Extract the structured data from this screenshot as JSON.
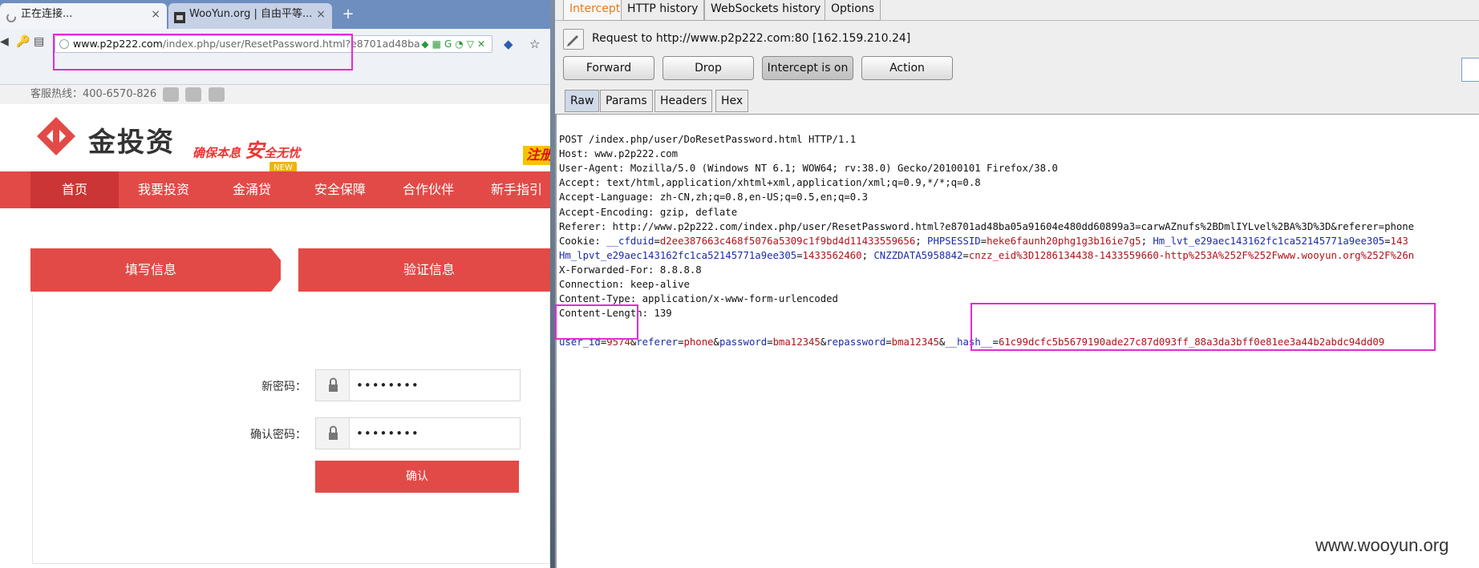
{
  "browser": {
    "tabs": [
      {
        "title": "正在连接...",
        "close": "×"
      },
      {
        "title": "WooYun.org | 自由平等...",
        "close": "×"
      }
    ],
    "new_tab": "+",
    "url_domain": "www.p2p222.com",
    "url_path": "/index.php/user/ResetPassword.html?e8701ad48ba"
  },
  "site": {
    "hotline": "客服热线：400-6570-826",
    "logo_text": "金投资",
    "slogan_pre": "确保本息",
    "slogan_big": "安",
    "slogan_post": "全无忧",
    "register_tag": "注册",
    "new_badge": "NEW",
    "nav": [
      "首页",
      "我要投资",
      "金涌贷",
      "安全保障",
      "合作伙伴",
      "新手指引"
    ],
    "steps": [
      "填写信息",
      "验证信息"
    ],
    "new_password_label": "新密码：",
    "confirm_password_label": "确认密码：",
    "new_password_value": "••••••••",
    "confirm_password_value": "••••••••",
    "confirm_button": "确认"
  },
  "burp": {
    "tabs": [
      "Intercept",
      "HTTP history",
      "WebSockets history",
      "Options"
    ],
    "request_to": "Request to http://www.p2p222.com:80  [162.159.210.24]",
    "buttons": [
      "Forward",
      "Drop",
      "Intercept is on",
      "Action"
    ],
    "sub_tabs": [
      "Raw",
      "Params",
      "Headers",
      "Hex"
    ],
    "raw_lines": [
      "POST /index.php/user/DoResetPassword.html HTTP/1.1",
      "Host: www.p2p222.com",
      "User-Agent: Mozilla/5.0 (Windows NT 6.1; WOW64; rv:38.0) Gecko/20100101 Firefox/38.0",
      "Accept: text/html,application/xhtml+xml,application/xml;q=0.9,*/*;q=0.8",
      "Accept-Language: zh-CN,zh;q=0.8,en-US;q=0.5,en;q=0.3",
      "Accept-Encoding: gzip, deflate",
      "Referer: http://www.p2p222.com/index.php/user/ResetPassword.html?e8701ad48ba05a91604e480dd60899a3=carwAZnufs%2BDmlIYLvel%2BA%3D%3D&referer=phone"
    ],
    "cookie_prefix": "Cookie: ",
    "cookie_parts": [
      {
        "k": "__cfduid",
        "v": "d2ee387663c468f5076a5309c1f9bd4d11433559656"
      },
      {
        "k": "PHPSESSID",
        "v": "heke6faunh20phg1g3b16ie7g5"
      },
      {
        "k": "Hm_lvt_e29aec143162fc1ca52145771a9ee305",
        "v": "143"
      }
    ],
    "cookie_line2": [
      {
        "k": "Hm_lpvt_e29aec143162fc1ca52145771a9ee305",
        "v": "1433562460"
      },
      {
        "k": "CNZZDATA5958842",
        "v": "cnzz_eid%3D1286134438-1433559660-http%253A%252F%252Fwww.wooyun.org%252F%26n"
      }
    ],
    "raw_lines_after": [
      "X-Forwarded-For: 8.8.8.8",
      "Connection: keep-alive",
      "Content-Type: application/x-www-form-urlencoded",
      "Content-Length: 139"
    ],
    "body_params": [
      {
        "k": "user_id",
        "v": "9574"
      },
      {
        "k": "referer",
        "v": "phone"
      },
      {
        "k": "password",
        "v": "bma12345"
      },
      {
        "k": "repassword",
        "v": "bma12345"
      },
      {
        "k": "__hash__",
        "v": "61c99dcfc5b5679190ade27c87d093ff_88a3da3bff0e81ee3a44b2abdc94dd09"
      }
    ]
  },
  "watermark": "www.wooyun.org",
  "colors": {
    "accent_red": "#e24a47",
    "highlight": "#e52ad8",
    "burp_orange": "#e87a1c"
  }
}
